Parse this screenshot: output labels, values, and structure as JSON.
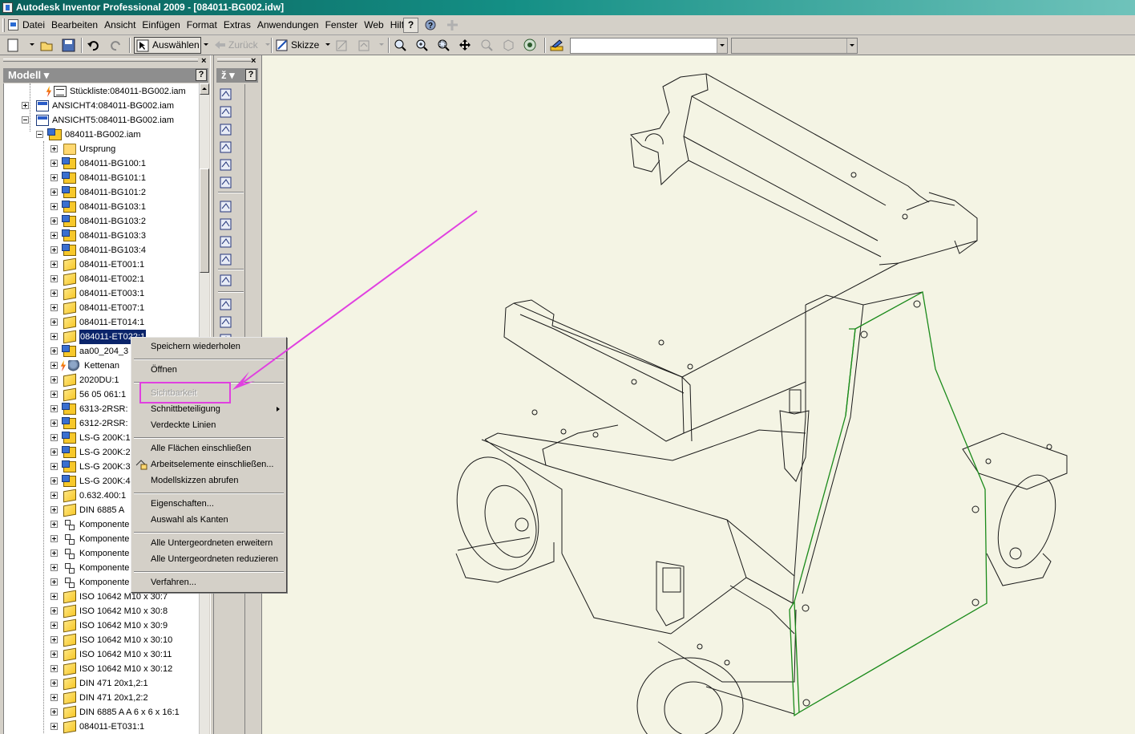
{
  "window": {
    "title": "Autodesk Inventor Professional 2009 - [084011-BG002.idw]"
  },
  "menu": {
    "items": [
      {
        "label": "Datei"
      },
      {
        "label": "Bearbeiten"
      },
      {
        "label": "Ansicht"
      },
      {
        "label": "Einfügen"
      },
      {
        "label": "Format"
      },
      {
        "label": "Extras"
      },
      {
        "label": "Anwendungen"
      },
      {
        "label": "Fenster"
      },
      {
        "label": "Web"
      },
      {
        "label": "Hilfe"
      }
    ],
    "help_glyph": "?"
  },
  "toolbar": {
    "select_label": "Auswählen",
    "back_label": "Zurück",
    "sketch_label": "Skizze",
    "combo1_value": "",
    "combo2_value": ""
  },
  "browser": {
    "title": "Modell",
    "help_glyph": "?",
    "tree": [
      {
        "label": "Stückliste:084011-BG002.iam",
        "icon": "bom-icon",
        "indent": 1,
        "expander": "none",
        "badge": "lightning"
      },
      {
        "label": "ANSICHT4:084011-BG002.iam",
        "icon": "view-icon",
        "indent": 0,
        "expander": "plus"
      },
      {
        "label": "ANSICHT5:084011-BG002.iam",
        "icon": "view-icon",
        "indent": 0,
        "expander": "minus"
      },
      {
        "label": "084011-BG002.iam",
        "icon": "assembly-icon",
        "indent": 1,
        "expander": "minus"
      },
      {
        "label": "Ursprung",
        "icon": "folder-icon",
        "indent": 2,
        "expander": "plus"
      },
      {
        "label": "084011-BG100:1",
        "icon": "assembly-icon",
        "indent": 2,
        "expander": "plus"
      },
      {
        "label": "084011-BG101:1",
        "icon": "assembly-icon",
        "indent": 2,
        "expander": "plus"
      },
      {
        "label": "084011-BG101:2",
        "icon": "assembly-icon",
        "indent": 2,
        "expander": "plus"
      },
      {
        "label": "084011-BG103:1",
        "icon": "assembly-icon",
        "indent": 2,
        "expander": "plus"
      },
      {
        "label": "084011-BG103:2",
        "icon": "assembly-icon",
        "indent": 2,
        "expander": "plus"
      },
      {
        "label": "084011-BG103:3",
        "icon": "assembly-icon",
        "indent": 2,
        "expander": "plus"
      },
      {
        "label": "084011-BG103:4",
        "icon": "assembly-icon",
        "indent": 2,
        "expander": "plus"
      },
      {
        "label": "084011-ET001:1",
        "icon": "part-icon",
        "indent": 2,
        "expander": "plus"
      },
      {
        "label": "084011-ET002:1",
        "icon": "part-icon",
        "indent": 2,
        "expander": "plus"
      },
      {
        "label": "084011-ET003:1",
        "icon": "part-icon",
        "indent": 2,
        "expander": "plus"
      },
      {
        "label": "084011-ET007:1",
        "icon": "part-icon",
        "indent": 2,
        "expander": "plus"
      },
      {
        "label": "084011-ET014:1",
        "icon": "part-icon",
        "indent": 2,
        "expander": "plus"
      },
      {
        "label": "084011-ET022:1",
        "icon": "part-icon",
        "indent": 2,
        "expander": "plus",
        "selected": true
      },
      {
        "label": "aa00_204_3",
        "icon": "assembly-icon",
        "indent": 2,
        "expander": "plus"
      },
      {
        "label": "Kettenan",
        "icon": "chain-icon",
        "indent": 2,
        "expander": "plus",
        "badge": "lightning"
      },
      {
        "label": "2020DU:1",
        "icon": "part-icon",
        "indent": 2,
        "expander": "plus"
      },
      {
        "label": "56 05 061:1",
        "icon": "part-icon",
        "indent": 2,
        "expander": "plus"
      },
      {
        "label": "6313-2RSR:",
        "icon": "assembly-icon",
        "indent": 2,
        "expander": "plus"
      },
      {
        "label": "6312-2RSR:",
        "icon": "assembly-icon",
        "indent": 2,
        "expander": "plus"
      },
      {
        "label": "LS-G 200K:1",
        "icon": "assembly-icon",
        "indent": 2,
        "expander": "plus"
      },
      {
        "label": "LS-G 200K:2",
        "icon": "assembly-icon",
        "indent": 2,
        "expander": "plus"
      },
      {
        "label": "LS-G 200K:3",
        "icon": "assembly-icon",
        "indent": 2,
        "expander": "plus"
      },
      {
        "label": "LS-G 200K:4",
        "icon": "assembly-icon",
        "indent": 2,
        "expander": "plus"
      },
      {
        "label": "0.632.400:1",
        "icon": "part-icon",
        "indent": 2,
        "expander": "plus"
      },
      {
        "label": "DIN 6885 A",
        "icon": "part-icon",
        "indent": 2,
        "expander": "plus"
      },
      {
        "label": "Komponente",
        "icon": "pattern-icon",
        "indent": 2,
        "expander": "plus"
      },
      {
        "label": "Komponente",
        "icon": "pattern-icon",
        "indent": 2,
        "expander": "plus"
      },
      {
        "label": "Komponente",
        "icon": "pattern-icon",
        "indent": 2,
        "expander": "plus"
      },
      {
        "label": "Komponente",
        "icon": "pattern-icon",
        "indent": 2,
        "expander": "plus"
      },
      {
        "label": "Komponente",
        "icon": "pattern-icon",
        "indent": 2,
        "expander": "plus"
      },
      {
        "label": "ISO 10642 M10 x  30:7",
        "icon": "part-icon",
        "indent": 2,
        "expander": "plus"
      },
      {
        "label": "ISO 10642 M10 x  30:8",
        "icon": "part-icon",
        "indent": 2,
        "expander": "plus"
      },
      {
        "label": "ISO 10642 M10 x  30:9",
        "icon": "part-icon",
        "indent": 2,
        "expander": "plus"
      },
      {
        "label": "ISO 10642 M10 x  30:10",
        "icon": "part-icon",
        "indent": 2,
        "expander": "plus"
      },
      {
        "label": "ISO 10642 M10 x  30:11",
        "icon": "part-icon",
        "indent": 2,
        "expander": "plus"
      },
      {
        "label": "ISO 10642 M10 x  30:12",
        "icon": "part-icon",
        "indent": 2,
        "expander": "plus"
      },
      {
        "label": "DIN 471 20x1,2:1",
        "icon": "part-icon",
        "indent": 2,
        "expander": "plus"
      },
      {
        "label": "DIN 471 20x1,2:2",
        "icon": "part-icon",
        "indent": 2,
        "expander": "plus"
      },
      {
        "label": "DIN 6885 A A 6 x 6 x 16:1",
        "icon": "part-icon",
        "indent": 2,
        "expander": "plus"
      },
      {
        "label": "084011-ET031:1",
        "icon": "part-icon",
        "indent": 2,
        "expander": "plus"
      }
    ]
  },
  "panel_bar": {
    "dropdown_label": "ž",
    "help_glyph": "?"
  },
  "context_menu": {
    "items": [
      {
        "label": "Speichern wiederholen",
        "enabled": true
      },
      {
        "separator": true
      },
      {
        "label": "Öffnen",
        "enabled": true
      },
      {
        "separator": true
      },
      {
        "label": "Sichtbarkeit",
        "enabled": false
      },
      {
        "label": "Schnittbeteiligung",
        "enabled": true,
        "submenu": true
      },
      {
        "label": "Verdeckte Linien",
        "enabled": true
      },
      {
        "separator": true
      },
      {
        "label": "Alle Flächen einschließen",
        "enabled": true
      },
      {
        "label": "Arbeitselemente einschließen...",
        "enabled": true,
        "icon": "work-features-icon"
      },
      {
        "label": "Modellskizzen abrufen",
        "enabled": true
      },
      {
        "separator": true
      },
      {
        "label": "Eigenschaften...",
        "enabled": true
      },
      {
        "label": "Auswahl als Kanten",
        "enabled": true
      },
      {
        "separator": true
      },
      {
        "label": "Alle Untergeordneten erweitern",
        "enabled": true
      },
      {
        "label": "Alle Untergeordneten reduzieren",
        "enabled": true
      },
      {
        "separator": true
      },
      {
        "label": "Verfahren...",
        "enabled": true
      }
    ]
  },
  "colors": {
    "annotation": "#e040e0",
    "drawing_line": "#1a1a1a",
    "highlight_edge": "#1a8a1a",
    "viewport_bg": "#f4f4e4",
    "selection": "#0a246a"
  }
}
